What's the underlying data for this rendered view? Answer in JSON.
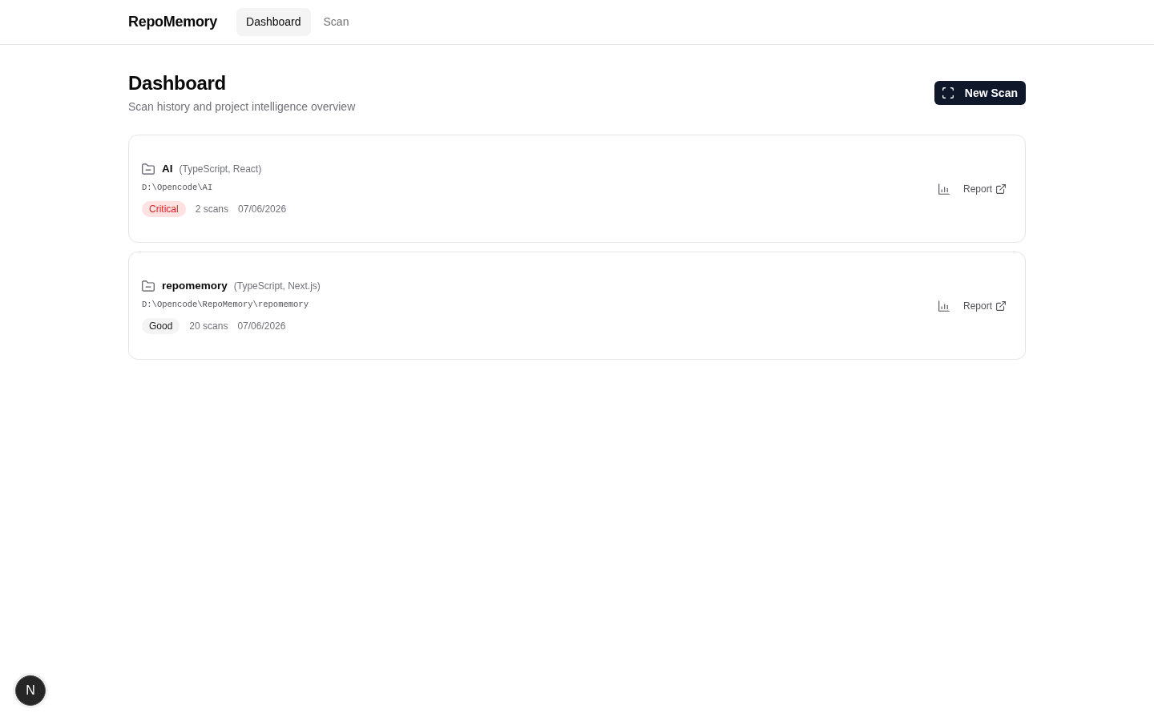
{
  "nav": {
    "brand": "RepoMemory",
    "tabs": [
      {
        "label": "Dashboard",
        "selected": true
      },
      {
        "label": "Scan",
        "selected": false
      }
    ]
  },
  "header": {
    "title": "Dashboard",
    "subtitle": "Scan history and project intelligence overview",
    "action": "New Scan"
  },
  "projects": [
    {
      "name": "AI",
      "stack": "(TypeScript, React)",
      "path": "D:\\Opencode\\AI",
      "status": {
        "label": "Critical",
        "kind": "critical"
      },
      "scans": "2 scans",
      "date": "07/06/2026",
      "link": "Report"
    },
    {
      "name": "repomemory",
      "stack": "(TypeScript, Next.js)",
      "path": "D:\\Opencode\\RepoMemory\\repomemory",
      "status": {
        "label": "Good",
        "kind": "good"
      },
      "scans": "20 scans",
      "date": "07/06/2026",
      "link": "Report"
    }
  ],
  "dev_indicator": {
    "label": "N"
  }
}
